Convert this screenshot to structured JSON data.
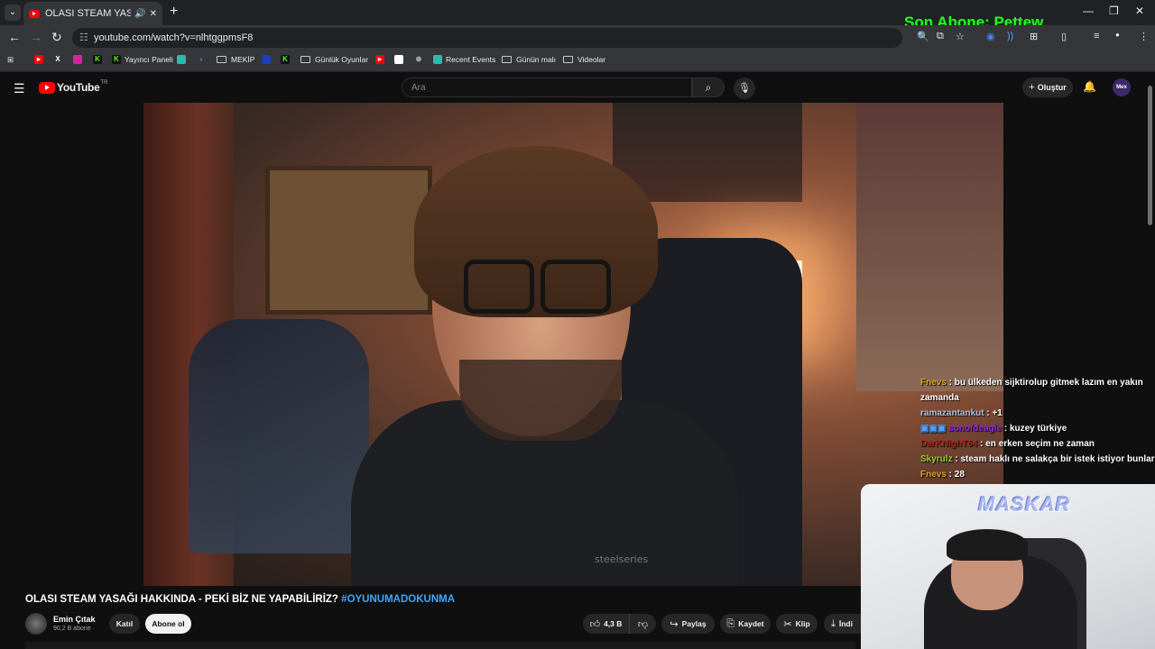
{
  "browser": {
    "tab": {
      "title": "OLASI STEAM YASAĞI HAKK"
    },
    "url": "youtube.com/watch?v=nlhtggpmsF8",
    "overlay_text": "Son Abone: Pettew",
    "bookmarks": [
      "Yayıncı Paneli",
      "MEKİP",
      "Günlük Oyunlar",
      "Recent Events",
      "Günün malı",
      "Videolar"
    ]
  },
  "youtube": {
    "logo": "YouTube",
    "logo_region": "TR",
    "search_placeholder": "Ara",
    "create_label": "Oluştur",
    "avatar_text": "Mex"
  },
  "chat": [
    {
      "user": "Fnevs",
      "message": "bu ülkeden sijktirolup gitmek lazım en yakın zamanda",
      "color": "#daa520"
    },
    {
      "user": "ramazantankut",
      "message": "+1",
      "color": "#b0c4de"
    },
    {
      "user": "sonofdeagle",
      "message": "kuzey türkiye",
      "color": "#8a2be2"
    },
    {
      "user": "DarKNighT64",
      "message": "en erken seçim ne zaman",
      "color": "#b22222"
    },
    {
      "user": "Skyrulz",
      "message": "steam haklı ne salakça bir istek istiyor bunlar",
      "color": "#9acd32"
    },
    {
      "user": "Fnevs",
      "message": "28",
      "color": "#daa520"
    }
  ],
  "webcam": {
    "overlay": "MASKAR"
  },
  "video": {
    "title": "OLASI STEAM YASAĞI HAKKINDA - PEKİ BİZ NE YAPABİLİRİZ?",
    "hashtag": "#OYUNUMADOKUNMA",
    "brand_on_shirt": "steelseries",
    "channel": {
      "name": "Emin Çıtak",
      "subscribers": "90,2 B abone"
    },
    "join_label": "Katıl",
    "subscribe_label": "Abone ol",
    "likes": "4,3 B",
    "share_label": "Paylaş",
    "save_label": "Kaydet",
    "clip_label": "Klip",
    "download_label": "İndi"
  }
}
